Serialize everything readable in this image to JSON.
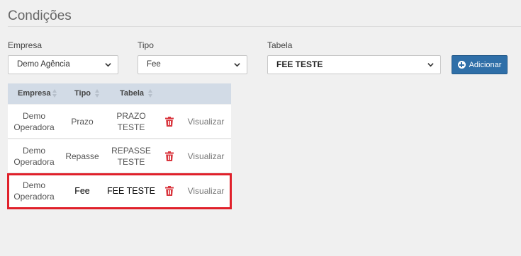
{
  "page": {
    "title": "Condições"
  },
  "filters": {
    "empresa": {
      "label": "Empresa",
      "value": "Demo Agência"
    },
    "tipo": {
      "label": "Tipo",
      "value": "Fee"
    },
    "tabela": {
      "label": "Tabela",
      "value": "FEE TESTE"
    },
    "add_label": "Adicionar"
  },
  "table": {
    "headers": [
      "Empresa",
      "Tipo",
      "Tabela"
    ],
    "rows": [
      {
        "empresa": "Demo Operadora",
        "tipo": "Prazo",
        "tabela": "PRAZO TESTE",
        "action": "Visualizar"
      },
      {
        "empresa": "Demo Operadora",
        "tipo": "Repasse",
        "tabela": "REPASSE TESTE",
        "action": "Visualizar"
      },
      {
        "empresa": "Demo Operadora",
        "tipo": "Fee",
        "tabela": "FEE TESTE",
        "action": "Visualizar"
      }
    ]
  },
  "colors": {
    "accent": "#2f6fa8",
    "danger": "#d9363e",
    "highlight": "#e0202a",
    "header_bg": "#d2dbe6"
  },
  "icons": {
    "add": "plus-circle-icon",
    "delete": "trash-icon",
    "dropdown": "chevron-down-icon",
    "sort": "sort-icon"
  }
}
